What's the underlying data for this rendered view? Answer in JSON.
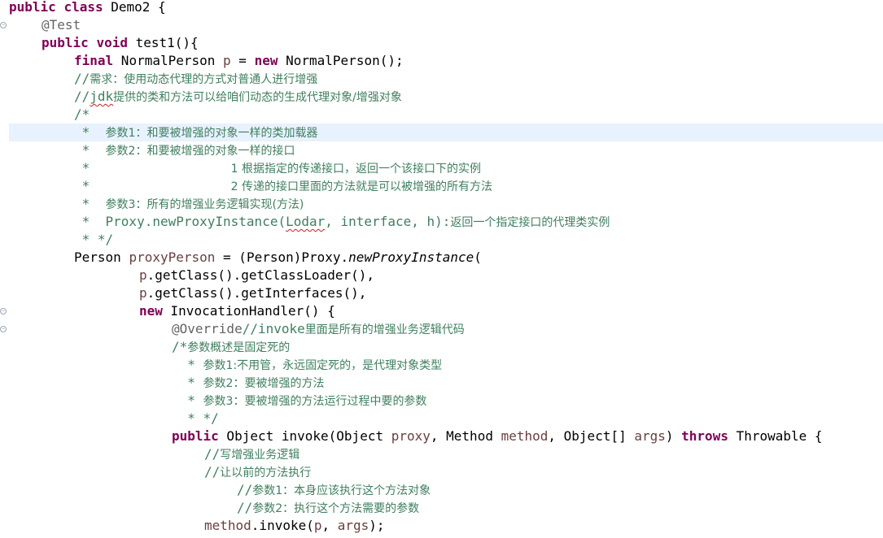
{
  "editor": {
    "lines": [
      {
        "indent": 0,
        "tokens": [
          [
            "kw",
            "public"
          ],
          [
            "pl",
            " "
          ],
          [
            "kw",
            "class"
          ],
          [
            "pl",
            " Demo2 {"
          ]
        ]
      },
      {
        "indent": 40,
        "fold": true,
        "tokens": [
          [
            "ann",
            "@Test"
          ]
        ]
      },
      {
        "indent": 40,
        "tokens": [
          [
            "kw",
            "public"
          ],
          [
            "pl",
            " "
          ],
          [
            "kw",
            "void"
          ],
          [
            "pl",
            " test1(){"
          ]
        ]
      },
      {
        "indent": 80,
        "tokens": [
          [
            "kw",
            "final"
          ],
          [
            "pl",
            " NormalPerson "
          ],
          [
            "fld",
            "p"
          ],
          [
            "pl",
            " = "
          ],
          [
            "kw",
            "new"
          ],
          [
            "pl",
            " NormalPerson();"
          ]
        ]
      },
      {
        "indent": 80,
        "tokens": [
          [
            "cm",
            "//"
          ],
          [
            "cmcn",
            "需求：使用动态代理的方式对普通人进行增强"
          ]
        ]
      },
      {
        "indent": 80,
        "tokens": [
          [
            "cm",
            "//"
          ],
          [
            "cmsq",
            "jdk"
          ],
          [
            "cmcn",
            "提供的类和方法可以给咱们动态的生成代理对象/增强对象"
          ]
        ]
      },
      {
        "indent": 80,
        "tokens": [
          [
            "cm",
            "/*"
          ]
        ]
      },
      {
        "indent": 80,
        "current": true,
        "tokens": [
          [
            "cm",
            " *  "
          ],
          [
            "cmcn",
            "参数1：和要被增强的对象一样的类加载器"
          ]
        ]
      },
      {
        "indent": 80,
        "tokens": [
          [
            "cm",
            " *  "
          ],
          [
            "cmcn",
            "参数2：和要被增强的对象一样的接口"
          ]
        ]
      },
      {
        "indent": 80,
        "tokens": [
          [
            "cm",
            " *                  "
          ],
          [
            "cmcn",
            "1 根据指定的传递接口，返回一个该接口下的实例"
          ]
        ]
      },
      {
        "indent": 80,
        "tokens": [
          [
            "cm",
            " *                  "
          ],
          [
            "cmcn",
            "2 传递的接口里面的方法就是可以被增强的所有方法"
          ]
        ]
      },
      {
        "indent": 80,
        "tokens": [
          [
            "cm",
            " *  "
          ],
          [
            "cmcn",
            "参数3：所有的增强业务逻辑实现(方法)"
          ]
        ]
      },
      {
        "indent": 80,
        "tokens": [
          [
            "cm",
            " *  Proxy.newProxyInstance("
          ],
          [
            "cmsq",
            "Lodar"
          ],
          [
            "cm",
            ", interface, h):"
          ],
          [
            "cmcn",
            "返回一个指定接口的代理类实例"
          ]
        ]
      },
      {
        "indent": 80,
        "tokens": [
          [
            "cm",
            " * */"
          ]
        ]
      },
      {
        "indent": 80,
        "tokens": [
          [
            "pl",
            "Person "
          ],
          [
            "fld",
            "proxyPerson"
          ],
          [
            "pl",
            " = (Person)Proxy."
          ],
          [
            "it",
            "newProxyInstance"
          ],
          [
            "pl",
            "("
          ]
        ]
      },
      {
        "indent": 160,
        "tokens": [
          [
            "fld",
            "p"
          ],
          [
            "pl",
            ".getClass().getClassLoader(),"
          ]
        ]
      },
      {
        "indent": 160,
        "tokens": [
          [
            "fld",
            "p"
          ],
          [
            "pl",
            ".getClass().getInterfaces(),"
          ]
        ]
      },
      {
        "indent": 160,
        "fold": true,
        "tokens": [
          [
            "kw",
            "new"
          ],
          [
            "pl",
            " InvocationHandler() {"
          ]
        ]
      },
      {
        "indent": 200,
        "fold": true,
        "tokens": [
          [
            "ann",
            "@Override"
          ],
          [
            "cm",
            "//invoke"
          ],
          [
            "cmcn",
            "里面是所有的增强业务逻辑代码"
          ]
        ]
      },
      {
        "indent": 200,
        "tokens": [
          [
            "cm",
            "/*"
          ],
          [
            "cmcn",
            "参数概述是固定死的"
          ]
        ]
      },
      {
        "indent": 200,
        "tokens": [
          [
            "cm",
            "  * "
          ],
          [
            "cmcn",
            "参数1:不用管，永远固定死的，是代理对象类型"
          ]
        ]
      },
      {
        "indent": 200,
        "tokens": [
          [
            "cm",
            "  * "
          ],
          [
            "cmcn",
            "参数2：要被增强的方法"
          ]
        ]
      },
      {
        "indent": 200,
        "tokens": [
          [
            "cm",
            "  * "
          ],
          [
            "cmcn",
            "参数3：要被增强的方法运行过程中要的参数"
          ]
        ]
      },
      {
        "indent": 200,
        "tokens": [
          [
            "cm",
            "  * */"
          ]
        ]
      },
      {
        "indent": 200,
        "tokens": [
          [
            "kw",
            "public"
          ],
          [
            "pl",
            " Object invoke(Object "
          ],
          [
            "fld",
            "proxy"
          ],
          [
            "pl",
            ", Method "
          ],
          [
            "fld",
            "method"
          ],
          [
            "pl",
            ", Object[] "
          ],
          [
            "fld",
            "args"
          ],
          [
            "pl",
            ") "
          ],
          [
            "kw",
            "throws"
          ],
          [
            "pl",
            " Throwable {"
          ]
        ]
      },
      {
        "indent": 240,
        "tokens": [
          [
            "cm",
            "//"
          ],
          [
            "cmcn",
            "写增强业务逻辑"
          ]
        ]
      },
      {
        "indent": 240,
        "tokens": [
          [
            "cm",
            "//"
          ],
          [
            "cmcn",
            "让以前的方法执行"
          ]
        ]
      },
      {
        "indent": 280,
        "tokens": [
          [
            "cm",
            "//"
          ],
          [
            "cmcn",
            "参数1：本身应该执行这个方法对象"
          ]
        ]
      },
      {
        "indent": 280,
        "tokens": [
          [
            "cm",
            "//"
          ],
          [
            "cmcn",
            "参数2：执行这个方法需要的参数"
          ]
        ]
      },
      {
        "indent": 240,
        "tokens": [
          [
            "fld",
            "method"
          ],
          [
            "pl",
            ".invoke("
          ],
          [
            "fld",
            "p"
          ],
          [
            "pl",
            ", "
          ],
          [
            "fld",
            "args"
          ],
          [
            "pl",
            ");"
          ]
        ]
      }
    ]
  }
}
